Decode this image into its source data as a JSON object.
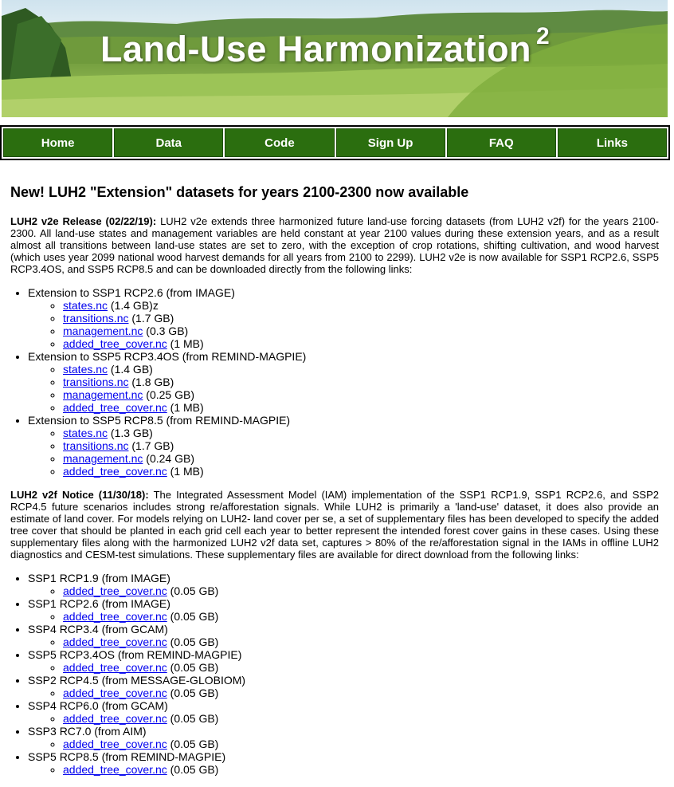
{
  "banner": {
    "title": "Land-Use Harmonization",
    "title_sup": "2"
  },
  "nav": [
    "Home",
    "Data",
    "Code",
    "Sign Up",
    "FAQ",
    "Links"
  ],
  "headline": "New! LUH2 \"Extension\" datasets for years 2100-2300 now available",
  "v2e": {
    "label": "LUH2 v2e Release (02/22/19):",
    "text": " LUH2 v2e extends three harmonized future land-use forcing datasets (from LUH2 v2f) for the years 2100-2300. All land-use states and management variables are held constant at year 2100 values during these extension years, and as a result almost all transitions between land-use states are set to zero, with the exception of crop rotations, shifting cultivation, and wood harvest (which uses year 2099 national wood harvest demands for all years from 2100 to 2299). LUH2 v2e is now available for SSP1 RCP2.6, SSP5 RCP3.4OS, and SSP5 RCP8.5 and can be downloaded directly from the following links:",
    "groups": [
      {
        "title": "Extension to SSP1 RCP2.6 (from IMAGE)",
        "files": [
          {
            "name": "states.nc",
            "size": " (1.4 GB)z"
          },
          {
            "name": "transitions.nc",
            "size": " (1.7 GB)"
          },
          {
            "name": "management.nc",
            "size": " (0.3 GB)"
          },
          {
            "name": "added_tree_cover.nc",
            "size": " (1 MB)"
          }
        ]
      },
      {
        "title": "Extension to SSP5 RCP3.4OS (from REMIND-MAGPIE)",
        "files": [
          {
            "name": "states.nc",
            "size": " (1.4 GB)"
          },
          {
            "name": "transitions.nc",
            "size": " (1.8 GB)"
          },
          {
            "name": "management.nc",
            "size": " (0.25 GB)"
          },
          {
            "name": "added_tree_cover.nc",
            "size": " (1 MB)"
          }
        ]
      },
      {
        "title": "Extension to SSP5 RCP8.5 (from REMIND-MAGPIE)",
        "files": [
          {
            "name": "states.nc",
            "size": " (1.3 GB)"
          },
          {
            "name": "transitions.nc",
            "size": " (1.7 GB)"
          },
          {
            "name": "management.nc",
            "size": " (0.24 GB)"
          },
          {
            "name": "added_tree_cover.nc",
            "size": " (1 MB)"
          }
        ]
      }
    ]
  },
  "v2f": {
    "label": "LUH2 v2f Notice (11/30/18):",
    "text": " The Integrated Assessment Model (IAM) implementation of the SSP1 RCP1.9, SSP1 RCP2.6, and SSP2 RCP4.5 future scenarios includes strong re/afforestation signals. While LUH2 is primarily a 'land-use' dataset, it does also provide an estimate of land cover. For models relying on LUH2- land cover per se, a set of supplementary files has been developed to specify the added tree cover that should be planted in each grid cell each year to better represent the intended forest cover gains in these cases. Using these supplementary files along with the harmonized LUH2 v2f data set, captures > 80% of the re/afforestation signal in the IAMs in offline LUH2 diagnostics and CESM-test simulations. These supplementary files are available for direct download from the following links:",
    "groups": [
      {
        "title": "SSP1 RCP1.9 (from IMAGE)",
        "files": [
          {
            "name": "added_tree_cover.nc",
            "size": " (0.05 GB)"
          }
        ]
      },
      {
        "title": "SSP1 RCP2.6 (from IMAGE)",
        "files": [
          {
            "name": "added_tree_cover.nc",
            "size": " (0.05 GB)"
          }
        ]
      },
      {
        "title": "SSP4 RCP3.4 (from GCAM)",
        "files": [
          {
            "name": "added_tree_cover.nc",
            "size": " (0.05 GB)"
          }
        ]
      },
      {
        "title": "SSP5 RCP3.4OS (from REMIND-MAGPIE)",
        "files": [
          {
            "name": "added_tree_cover.nc",
            "size": " (0.05 GB)"
          }
        ]
      },
      {
        "title": "SSP2 RCP4.5 (from MESSAGE-GLOBIOM)",
        "files": [
          {
            "name": "added_tree_cover.nc",
            "size": " (0.05 GB)"
          }
        ]
      },
      {
        "title": "SSP4 RCP6.0 (from GCAM)",
        "files": [
          {
            "name": "added_tree_cover.nc",
            "size": " (0.05 GB)"
          }
        ]
      },
      {
        "title": "SSP3 RC7.0 (from AIM)",
        "files": [
          {
            "name": "added_tree_cover.nc",
            "size": " (0.05 GB)"
          }
        ]
      },
      {
        "title": "SSP5 RCP8.5 (from REMIND-MAGPIE)",
        "files": [
          {
            "name": "added_tree_cover.nc",
            "size": " (0.05 GB)"
          }
        ]
      }
    ]
  }
}
